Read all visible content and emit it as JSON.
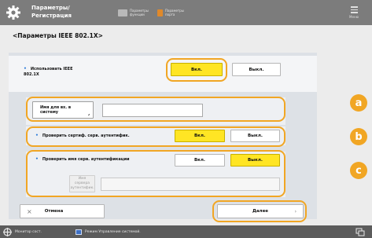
{
  "header": {
    "title": "Параметры/ Регистрация",
    "btn_a_label": "Параметры функции",
    "btn_b_label": "Параметры порта",
    "menu_label": "Меню"
  },
  "page": {
    "subtitle": "<Параметры IEEE 802.1X>"
  },
  "ieee": {
    "label": "Использовать IEEE 802.1X",
    "on_label": "Вкл.",
    "off_label": "Выкл."
  },
  "login": {
    "label": "Имя для вх. в систему",
    "value": ""
  },
  "cert_check": {
    "label": "Проверить сертиф. серв. аутентифик.",
    "on_label": "Вкл.",
    "off_label": "Выкл."
  },
  "name_check": {
    "label": "Проверить имя серв. аутентификации",
    "on_label": "Вкл.",
    "off_label": "Выкл.",
    "server_label": "Имя сервера аутентифик.",
    "server_value": ""
  },
  "actions": {
    "cancel_label": "Отмена",
    "next_label": "Далее"
  },
  "badges": {
    "a": "a",
    "b": "b",
    "c": "c"
  },
  "statusbar": {
    "monitor_label": "Монитор сост.",
    "mode_label": "Режим Управление системой."
  },
  "colors": {
    "topbar": "#7c7c7c",
    "selected": "#ffe524",
    "highlight": "#f1a624",
    "bullet": "#2a7ad8",
    "statusbar": "#5c5c5c"
  }
}
